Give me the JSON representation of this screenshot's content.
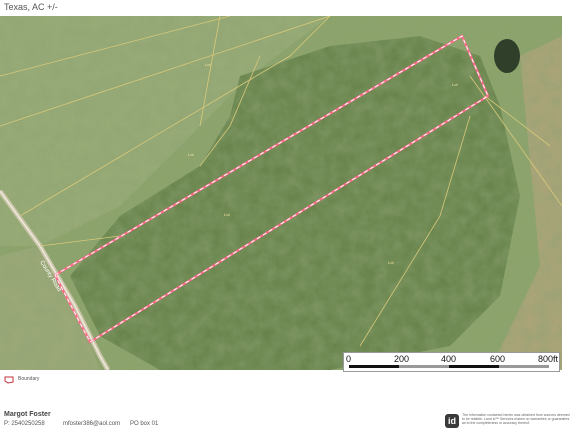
{
  "header": {
    "title": "Texas,  AC +/-"
  },
  "map": {
    "road_label": "County Road",
    "parcel_label": "Lot",
    "colors": {
      "parcel_boundary": "#ff6b8a",
      "parcel_lines": "#d8c97a",
      "pasture": "#8fa768",
      "brush": "#5d7a40"
    }
  },
  "scale_bar": {
    "ticks": [
      "0",
      "200",
      "400",
      "600",
      "800ft"
    ]
  },
  "legend": {
    "label": "Boundary",
    "swatch_color": "#c0303a"
  },
  "footer": {
    "name": "Margot Foster",
    "phone": "P: 2540250258",
    "email": "mfoster386@aol.com",
    "po_box": "PO box 01",
    "logo_text": "id",
    "disclaimer": "The information contained herein was obtained from sources deemed to be reliable. Land id™ Services makes no warranties or guarantees as to the completeness or accuracy thereof."
  }
}
